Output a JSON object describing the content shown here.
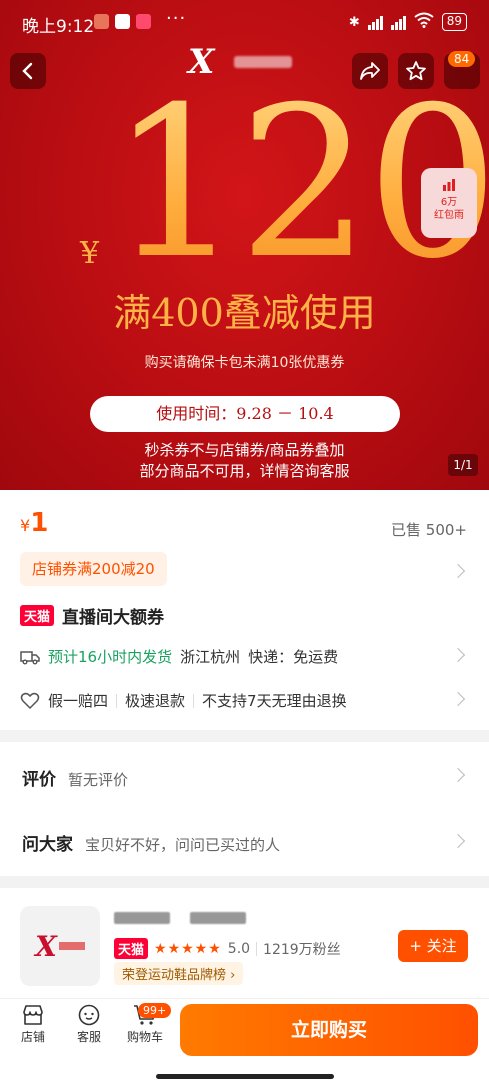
{
  "status": {
    "time": "晚上9:12",
    "more": "···",
    "battery": "89"
  },
  "hero": {
    "yen": "¥",
    "amount": "120",
    "subline": "满400叠减使用",
    "note1": "购买请确保卡包未满10张优惠券",
    "time_pill": "使用时间：9.28 － 10.4",
    "note2_line1": "秒杀券不与店铺券/商品券叠加",
    "note2_line2": "部分商品不可用，详情咨询客服",
    "pager": "1/1",
    "cart_count": "84",
    "rain_line1": "6万",
    "rain_line2": "红包雨"
  },
  "colors": {
    "accent": "#ff5000",
    "hero_red": "#b80d12",
    "gold": "#ffb347",
    "tmall_red": "#ff0036",
    "green": "#1aa260"
  },
  "product": {
    "price_symbol": "¥",
    "price": "1",
    "sold": "已售 500+",
    "coupon": "店铺券满200减20",
    "tmall_tag": "天猫",
    "promo_title": "直播间大额券",
    "ship_eta": "预计16小时内发货",
    "ship_from": "浙江杭州",
    "ship_fee": "快递：免运费",
    "svc1": "假一赔四",
    "svc2": "极速退款",
    "svc3": "不支持7天无理由退换"
  },
  "reviews": {
    "label": "评价",
    "value": "暂无评价",
    "ask_label": "问大家",
    "ask_value": "宝贝好不好，问问已买过的人"
  },
  "shop": {
    "logo_letter": "X",
    "tmall_tag": "天猫",
    "stars": "★★★★★",
    "rating": "5.0",
    "fans": "1219万粉丝",
    "rank": "荣登运动鞋品牌榜",
    "rank_chevron": "›",
    "follow": "+ 关注"
  },
  "bottom": {
    "tab_shop": "店铺",
    "tab_service": "客服",
    "tab_cart": "购物车",
    "cart_badge": "99+",
    "buy": "立即购买"
  },
  "icons": [
    "back-icon",
    "share-icon",
    "star-icon",
    "more-icon",
    "bluetooth-icon",
    "wifi-icon",
    "truck-icon",
    "heart-icon",
    "shop-icon",
    "service-icon",
    "cart-icon",
    "chart-icon"
  ]
}
